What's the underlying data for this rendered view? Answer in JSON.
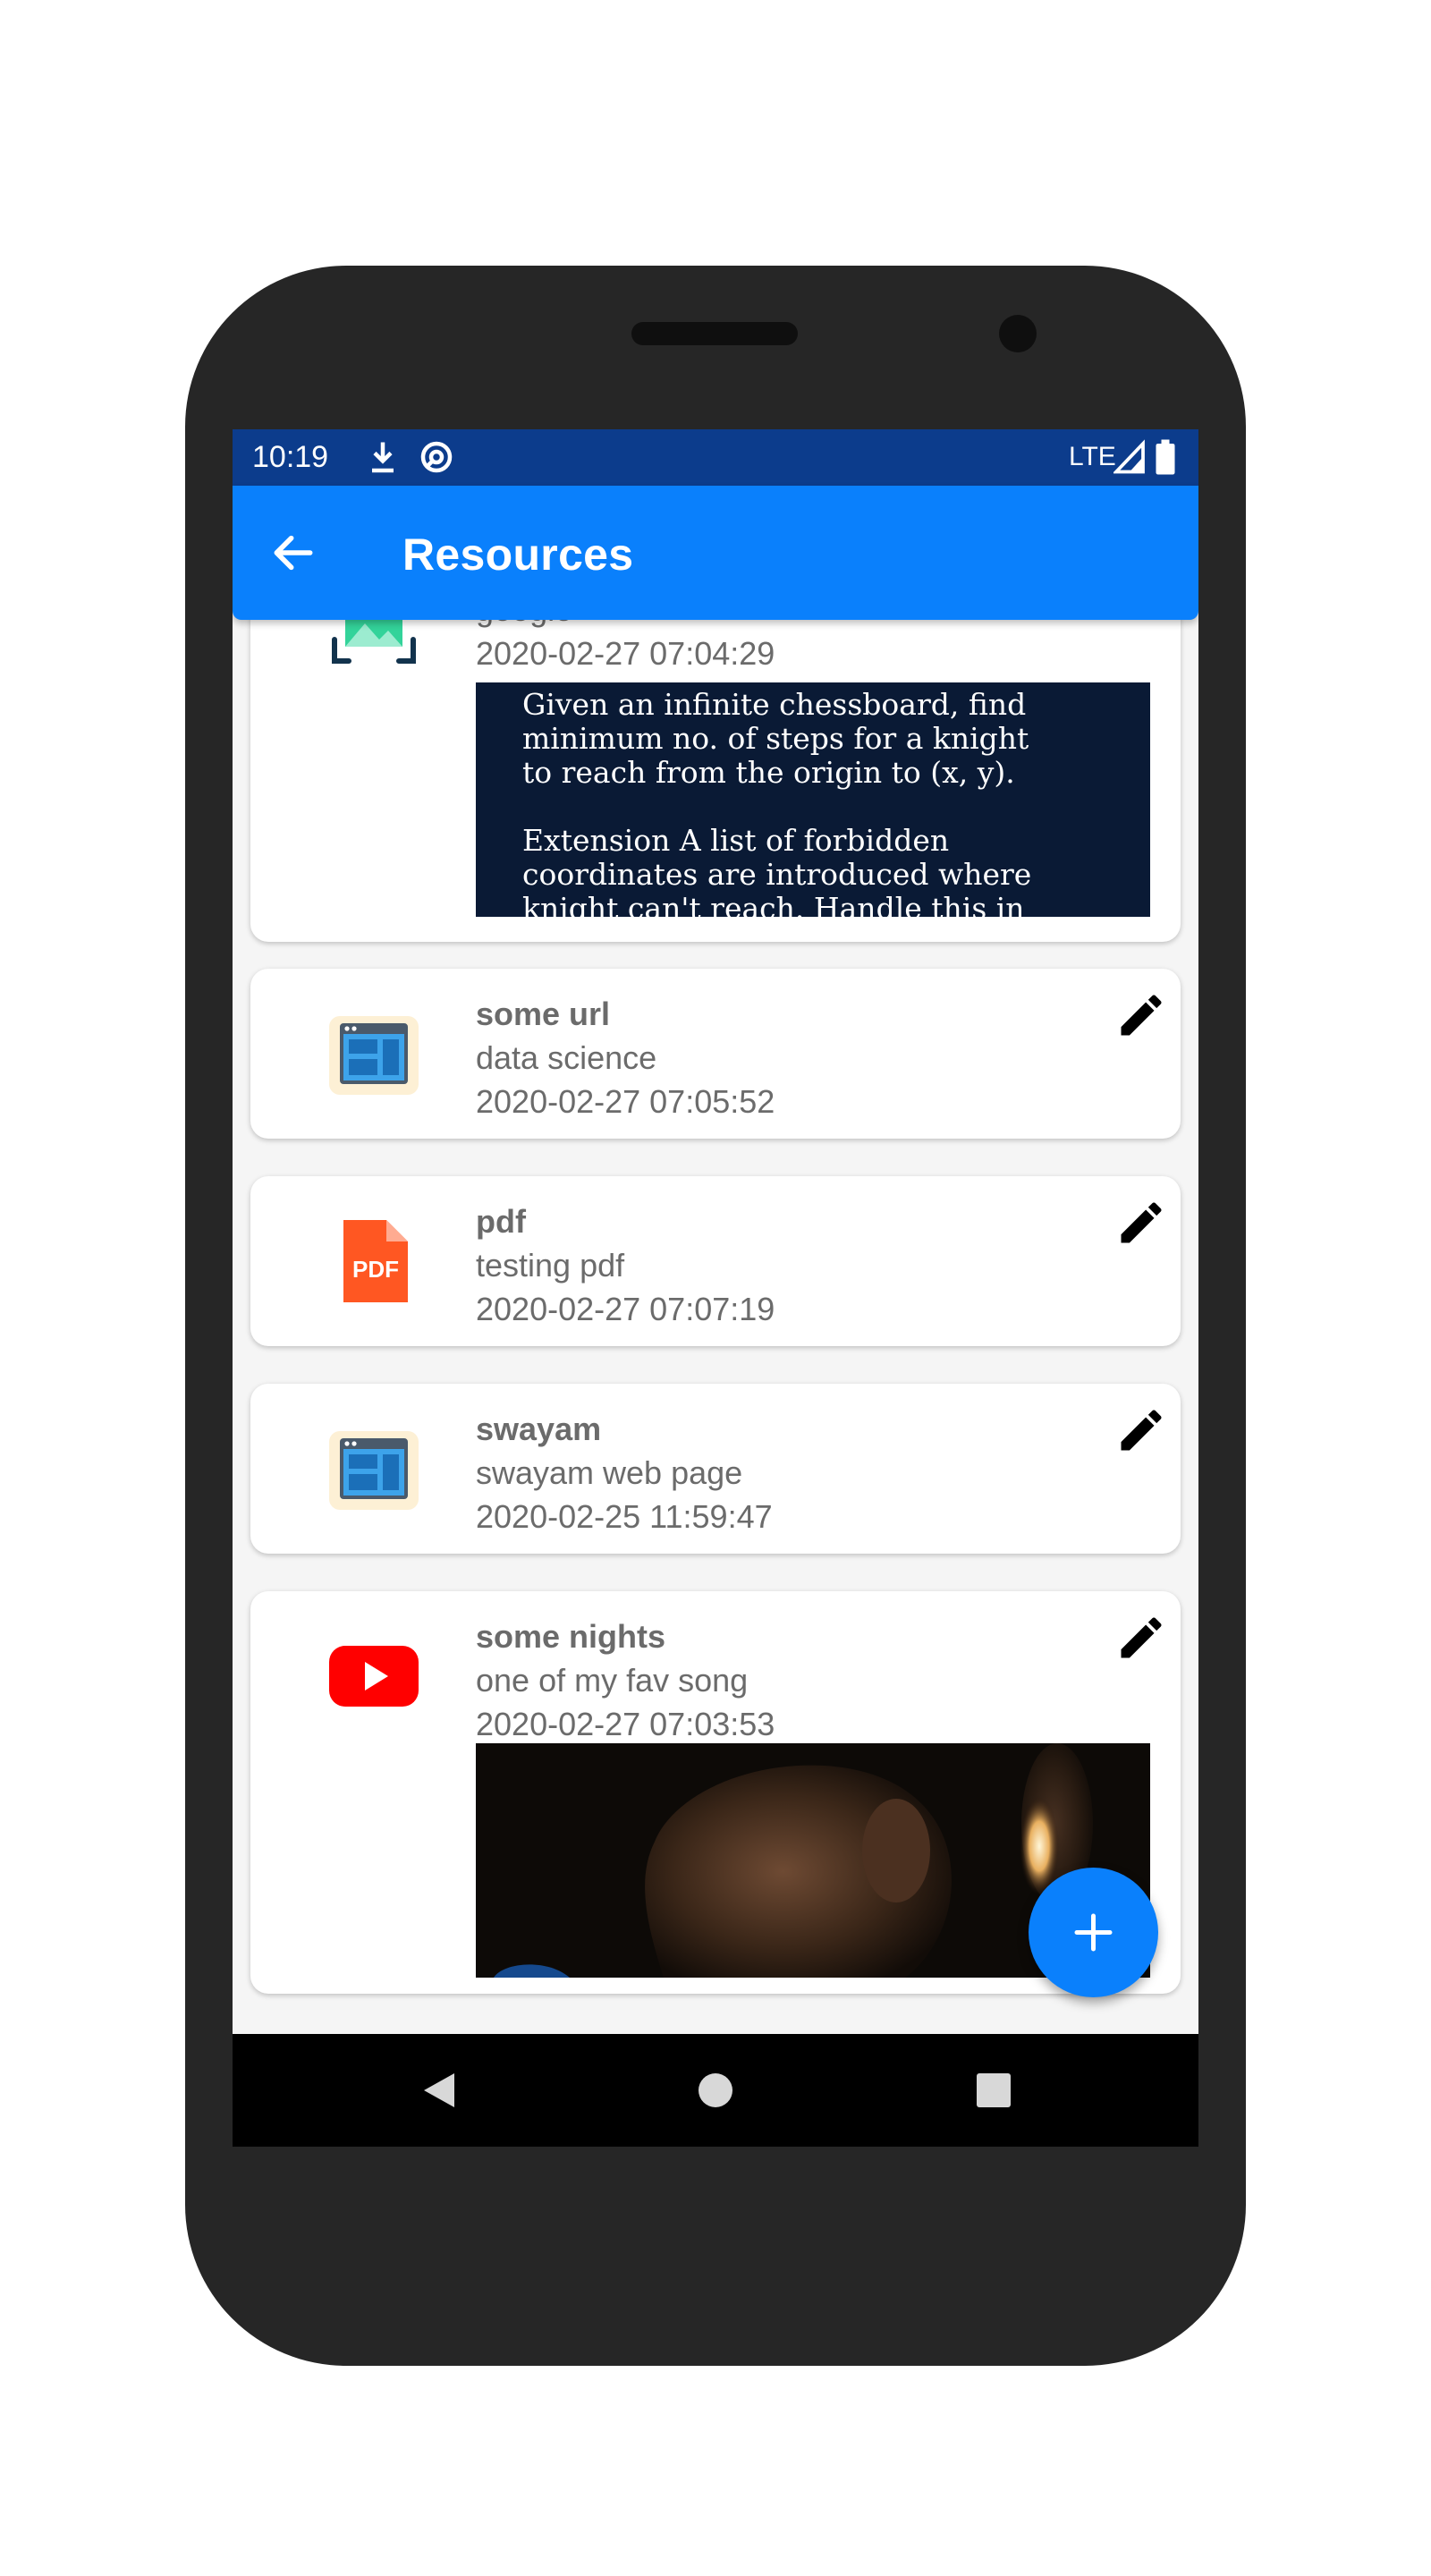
{
  "status_bar": {
    "time": "10:19",
    "network": "LTE",
    "icons": [
      "download-icon",
      "sync-icon",
      "signal-icon",
      "battery-icon"
    ]
  },
  "app_bar": {
    "title": "Resources",
    "back_icon": "arrow-back-icon"
  },
  "resources": [
    {
      "title": "",
      "description": "google",
      "date": "2020-02-27 07:04:29",
      "icon": "image-icon",
      "preview_text": "Given an infinite chessboard, find\nminimum no. of steps for a knight\nto reach from the origin to (x, y).\n\nExtension A list of forbidden\ncoordinates are introduced where\nknight can't reach. Handle this in"
    },
    {
      "title": "some url",
      "description": "data science",
      "date": "2020-02-27 07:05:52",
      "icon": "web-page-icon"
    },
    {
      "title": "pdf",
      "description": "testing pdf",
      "date": "2020-02-27 07:07:19",
      "icon": "pdf-icon",
      "icon_label": "PDF"
    },
    {
      "title": "swayam",
      "description": "swayam web page",
      "date": "2020-02-25 11:59:47",
      "icon": "web-page-icon"
    },
    {
      "title": "some nights",
      "description": "one of my fav song",
      "date": "2020-02-27 07:03:53",
      "icon": "youtube-icon"
    }
  ],
  "fab": {
    "icon": "plus-icon"
  },
  "nav_bar": {
    "icons": [
      "back-triangle-icon",
      "home-circle-icon",
      "recents-square-icon"
    ]
  },
  "colors": {
    "primary": "#0a80fc",
    "status_bar": "#0c3c8c",
    "text_secondary": "#6b6b6b",
    "pdf": "#ff5722",
    "youtube": "#ff0000"
  }
}
